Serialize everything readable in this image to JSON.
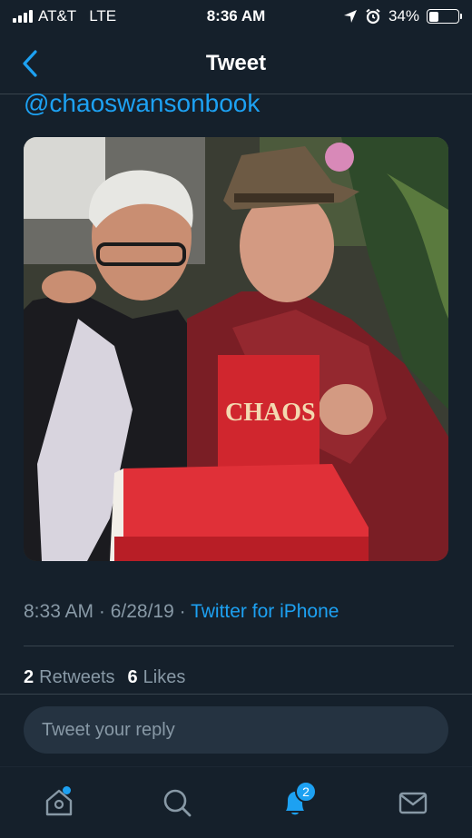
{
  "status_bar": {
    "carrier": "AT&T",
    "network": "LTE",
    "time": "8:36 AM",
    "battery_percent": "34%",
    "battery_level": 0.34
  },
  "nav": {
    "title": "Tweet",
    "back_icon": "chevron-left-icon"
  },
  "tweet": {
    "handle_link": "@chaoswansonbook",
    "photo_book_text": "CHAOS",
    "timestamp": "8:33 AM · 6/28/19 · ",
    "source": "Twitter for iPhone",
    "retweets_count": "2",
    "retweets_label": "Retweets",
    "likes_count": "6",
    "likes_label": "Likes"
  },
  "reply": {
    "placeholder": "Tweet your reply"
  },
  "tab_bar": {
    "items": [
      {
        "icon": "home-icon"
      },
      {
        "icon": "search-icon"
      },
      {
        "icon": "notifications-icon",
        "badge": "2"
      },
      {
        "icon": "messages-icon"
      }
    ]
  },
  "colors": {
    "background": "#15202b",
    "accent": "#1da1f2",
    "secondary_text": "#8899a6",
    "divider": "#38444d"
  }
}
